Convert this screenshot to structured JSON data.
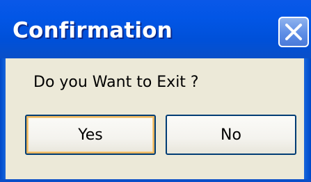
{
  "dialog": {
    "title": "Confirmation",
    "message": "Do you Want to Exit ?",
    "close_icon": "close-icon"
  },
  "buttons": {
    "yes_label": "Yes",
    "no_label": "No"
  },
  "colors": {
    "titlebar": "#0256e6",
    "body": "#ece9d8",
    "button_border": "#003c74",
    "default_focus": "#f9cf86"
  }
}
